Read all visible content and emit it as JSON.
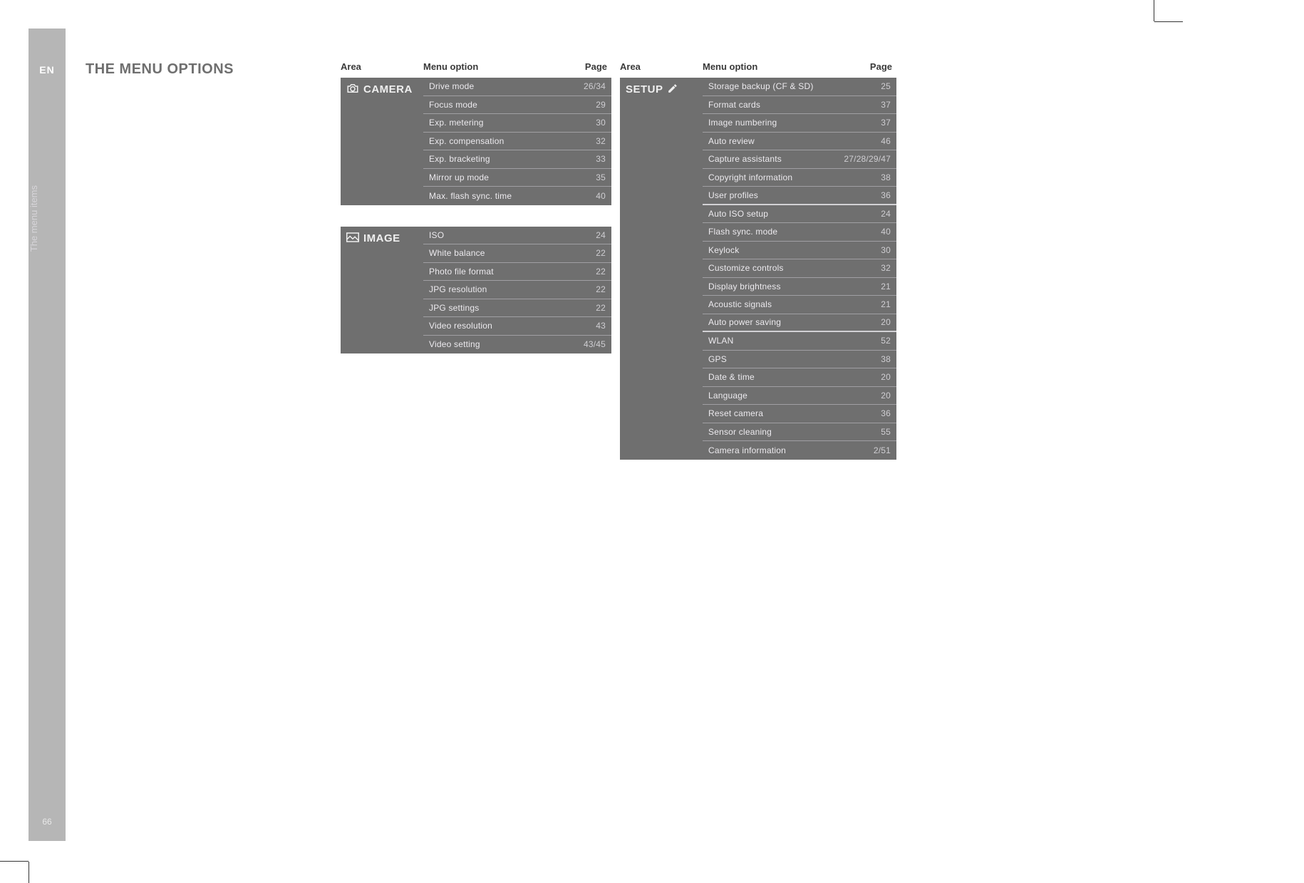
{
  "sidebar": {
    "lang": "EN",
    "tab": "The menu items",
    "page_number": "66"
  },
  "title": "THE MENU OPTIONS",
  "headers": {
    "area": "Area",
    "option": "Menu option",
    "page": "Page"
  },
  "sections": {
    "camera": {
      "label": "CAMERA",
      "icon": "camera-icon",
      "rows": [
        {
          "opt": "Drive mode",
          "pg": "26/34"
        },
        {
          "opt": "Focus mode",
          "pg": "29"
        },
        {
          "opt": "Exp. metering",
          "pg": "30"
        },
        {
          "opt": "Exp. compensation",
          "pg": "32"
        },
        {
          "opt": "Exp. bracketing",
          "pg": "33"
        },
        {
          "opt": "Mirror up mode",
          "pg": "35"
        },
        {
          "opt": "Max. flash sync. time",
          "pg": "40"
        }
      ]
    },
    "image": {
      "label": "IMAGE",
      "icon": "image-icon",
      "rows": [
        {
          "opt": "ISO",
          "pg": "24"
        },
        {
          "opt": "White balance",
          "pg": "22"
        },
        {
          "opt": "Photo file format",
          "pg": "22"
        },
        {
          "opt": "JPG resolution",
          "pg": "22"
        },
        {
          "opt": "JPG settings",
          "pg": "22"
        },
        {
          "opt": "Video resolution",
          "pg": "43"
        },
        {
          "opt": "Video setting",
          "pg": "43/45"
        }
      ]
    },
    "setup": {
      "label": "SETUP",
      "icon": "tools-icon",
      "rows": [
        {
          "opt": "Storage backup (CF & SD)",
          "pg": "25"
        },
        {
          "opt": "Format cards",
          "pg": "37"
        },
        {
          "opt": "Image numbering",
          "pg": "37"
        },
        {
          "opt": "Auto review",
          "pg": "46"
        },
        {
          "opt": "Capture assistants",
          "pg": "27/28/29/47"
        },
        {
          "opt": "Copyright information",
          "pg": "38"
        },
        {
          "opt": "User profiles",
          "pg": "36",
          "group_end": true
        },
        {
          "opt": "Auto ISO setup",
          "pg": "24"
        },
        {
          "opt": "Flash sync. mode",
          "pg": "40"
        },
        {
          "opt": "Keylock",
          "pg": "30"
        },
        {
          "opt": "Customize controls",
          "pg": "32"
        },
        {
          "opt": "Display brightness",
          "pg": "21"
        },
        {
          "opt": "Acoustic signals",
          "pg": "21"
        },
        {
          "opt": "Auto power saving",
          "pg": "20",
          "group_end": true
        },
        {
          "opt": "WLAN",
          "pg": "52"
        },
        {
          "opt": "GPS",
          "pg": "38"
        },
        {
          "opt": "Date & time",
          "pg": "20"
        },
        {
          "opt": "Language",
          "pg": "20"
        },
        {
          "opt": "Reset camera",
          "pg": "36"
        },
        {
          "opt": "Sensor cleaning",
          "pg": "55"
        },
        {
          "opt": "Camera information",
          "pg": "2/51"
        }
      ]
    }
  }
}
